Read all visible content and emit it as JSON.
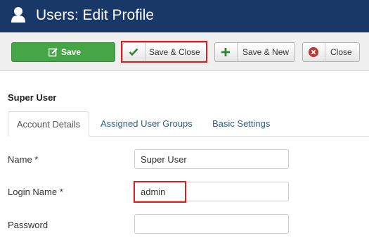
{
  "header": {
    "title": "Users: Edit Profile",
    "icon": "user-icon"
  },
  "toolbar": {
    "save_label": "Save",
    "save_close_label": "Save & Close",
    "save_new_label": "Save & New",
    "close_label": "Close"
  },
  "form": {
    "section_title": "Super User",
    "tabs": [
      {
        "label": "Account Details",
        "active": true
      },
      {
        "label": "Assigned User Groups",
        "active": false
      },
      {
        "label": "Basic Settings",
        "active": false
      }
    ],
    "fields": [
      {
        "label": "Name *",
        "value": "Super User"
      },
      {
        "label": "Login Name *",
        "value": "admin"
      },
      {
        "label": "Password",
        "value": ""
      }
    ]
  },
  "colors": {
    "header_bg": "#1a3867",
    "save_green": "#46a546",
    "check_green": "#378137",
    "close_red": "#bd362f",
    "highlight_red": "#e21b1b",
    "link_blue": "#2a6496"
  }
}
